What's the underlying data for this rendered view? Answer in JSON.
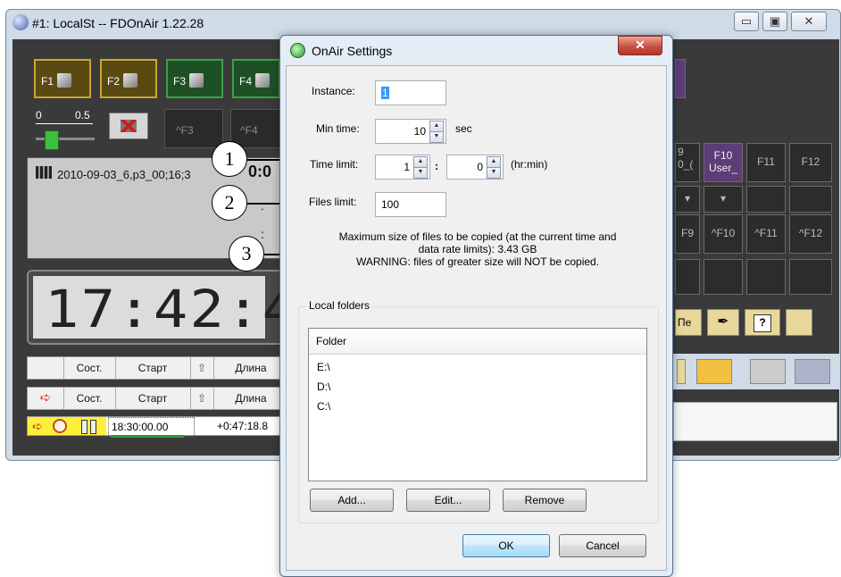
{
  "main_window": {
    "title": "#1: LocalSt -- FDOnAir 1.22.28",
    "controls": [
      "▭",
      "▣",
      "✕"
    ]
  },
  "fkeys": {
    "top_row": [
      "F1",
      "F2",
      "F3",
      "F4"
    ],
    "second_row": [
      "^F3",
      "^F4"
    ],
    "slider_scale": [
      "0",
      "0.5"
    ]
  },
  "clip": {
    "name": "2010-09-03_6,p3_00;16;3",
    "time_partial": "0:0"
  },
  "clock": {
    "time": "17:42:41"
  },
  "playlist": {
    "columns": [
      "Сост.",
      "Старт",
      "Длина"
    ],
    "row": {
      "start": "18:30:00.00",
      "length": "+0:47:18.8"
    }
  },
  "right_panel": {
    "f_keys": [
      "F10",
      "F11",
      "F12"
    ],
    "f10_sub": "User_",
    "f9_partial": "9",
    "f9_sub_partial": "0_(",
    "ctrl_keys": [
      "F9",
      "^F10",
      "^F11",
      "^F12"
    ],
    "pe_label": "Пе"
  },
  "callouts": [
    "1",
    "2",
    "3"
  ],
  "dialog": {
    "title": "OnAir Settings",
    "instance_label": "Instance:",
    "instance_value": "1",
    "min_time_label": "Min time:",
    "min_time_value": "10",
    "min_time_unit": "sec",
    "time_limit_label": "Time limit:",
    "time_limit_hours": "1",
    "time_limit_minutes": "0",
    "time_limit_sep": ":",
    "time_limit_unit": "(hr:min)",
    "files_limit_label": "Files limit:",
    "files_limit_value": "100",
    "info_line1": "Maximum size of files to be copied (at the current time and",
    "info_line2": "data rate limits): 3.43 GB",
    "info_line3": "WARNING: files of greater size will NOT be copied.",
    "group_label": "Local folders",
    "list_header": "Folder",
    "folders": [
      "E:\\",
      "D:\\",
      "C:\\"
    ],
    "add_label": "Add...",
    "edit_label": "Edit...",
    "remove_label": "Remove",
    "ok_label": "OK",
    "cancel_label": "Cancel"
  }
}
